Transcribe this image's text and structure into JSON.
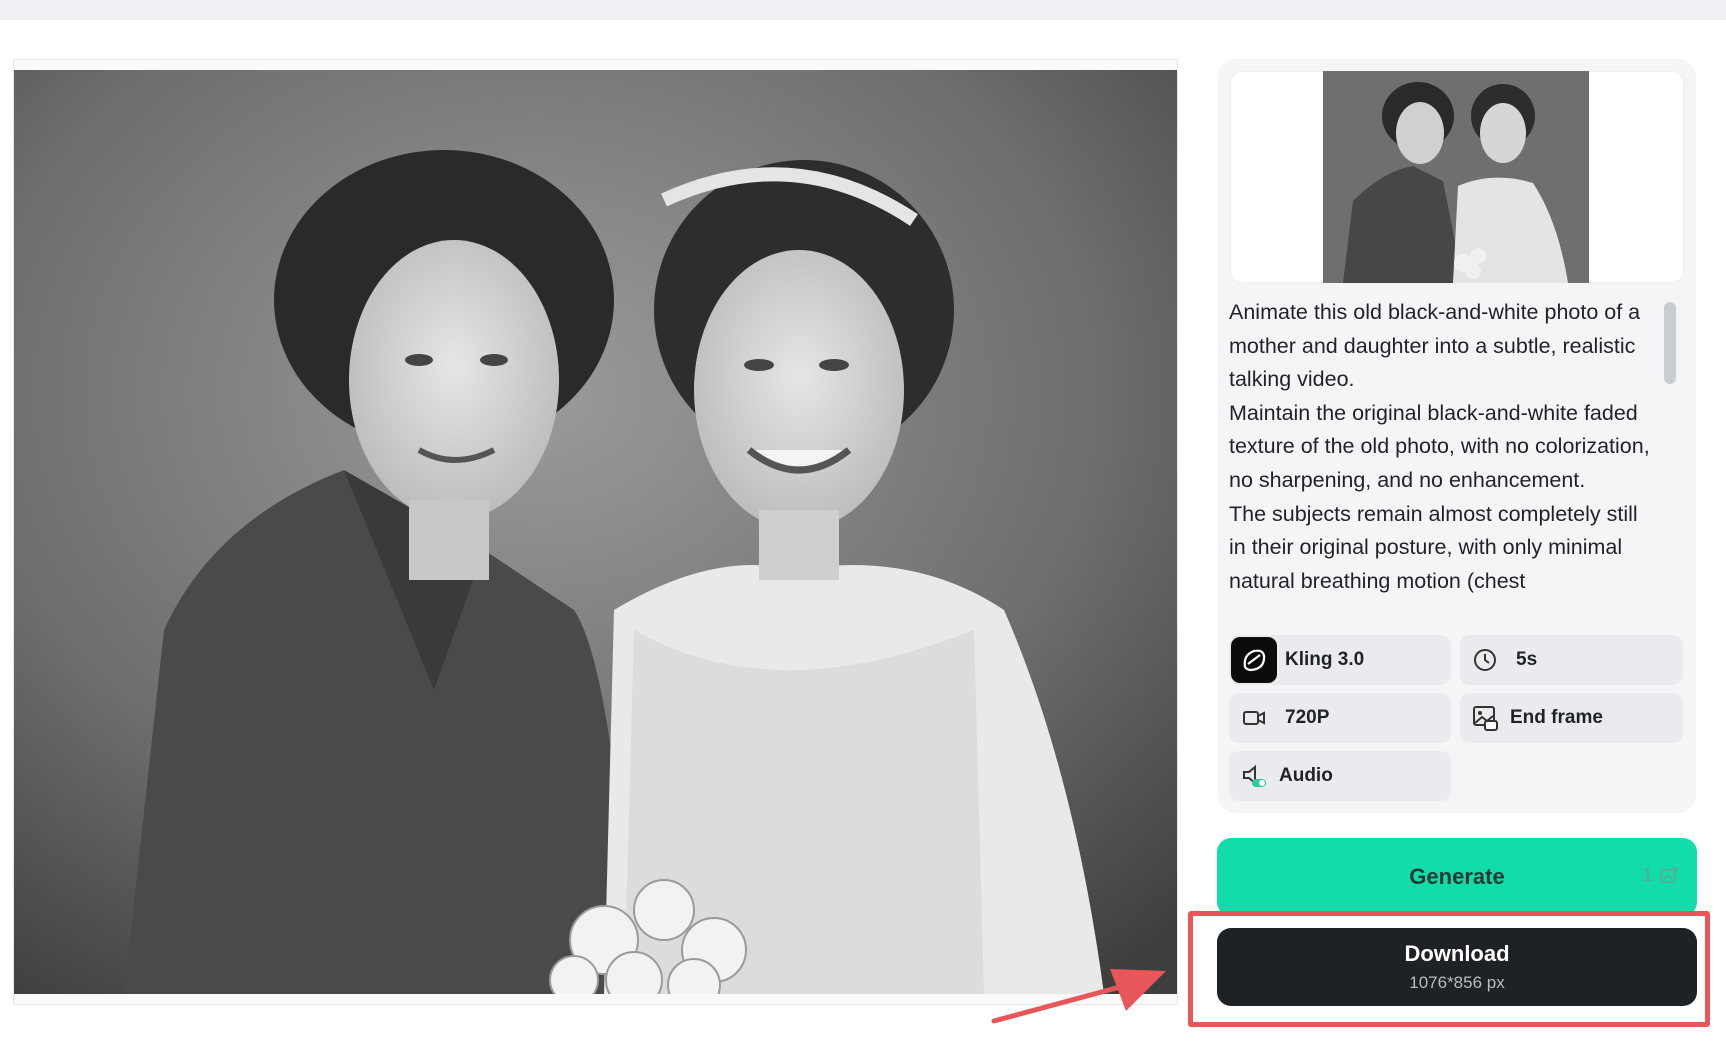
{
  "preview": {
    "image_alt": "Black-and-white portrait of a mother and daughter in wedding attire"
  },
  "side_panel": {
    "thumbnail_alt": "Thumbnail of uploaded photo",
    "prompt_lines": [
      "Animate this old black-and-white photo of a mother and daughter into a subtle, realistic talking video.",
      "Maintain the original black-and-white faded texture of the old photo, with no colorization, no sharpening, and no enhancement.",
      "The subjects remain almost completely still in their original posture, with only minimal natural breathing motion (chest"
    ],
    "options": {
      "model": {
        "label": "Kling 3.0",
        "icon": "kling-logo-icon"
      },
      "duration": {
        "label": "5s",
        "icon": "clock-icon"
      },
      "resolution": {
        "label": "720P",
        "icon": "video-camera-icon"
      },
      "end_frame": {
        "label": "End frame",
        "icon": "image-frame-icon"
      },
      "audio": {
        "label": "Audio",
        "icon": "audio-toggle-icon"
      }
    }
  },
  "actions": {
    "generate_label": "Generate",
    "generate_cost": "1",
    "download_label": "Download",
    "download_size": "1076*856 px"
  },
  "colors": {
    "generate_bg": "#11dcaa",
    "download_bg": "#1e2126",
    "highlight": "#e8565a"
  }
}
